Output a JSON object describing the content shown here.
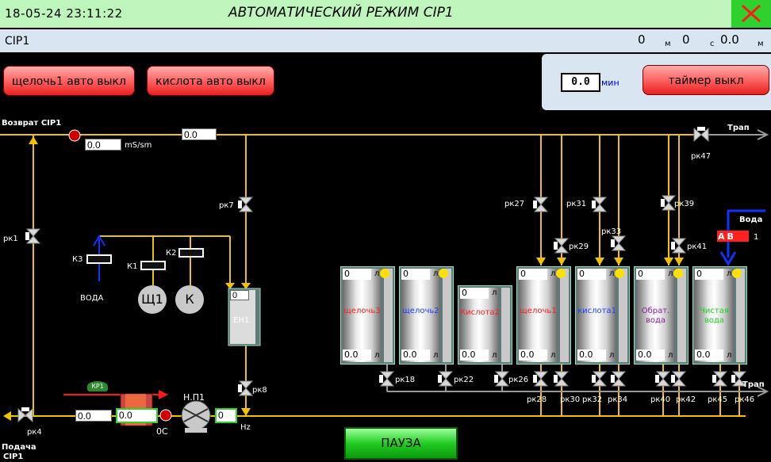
{
  "header": {
    "datetime": "18-05-24 23:11:22",
    "title": "АВТОМАТИЧЕСКИЙ РЕЖИМ CIP1"
  },
  "subheader": {
    "name": "CIP1",
    "h": "0",
    "h_unit": "м",
    "m": "0",
    "m_unit": "с",
    "s": "0.0",
    "s_unit": "м"
  },
  "buttons": {
    "alkali": "щелочь1 авто выкл",
    "acid": "кислота авто выкл",
    "timer": "таймер выкл",
    "pause": "ПАУЗА"
  },
  "timer": {
    "value": "0.0",
    "unit": "мин"
  },
  "process": {
    "return_label": "Возврат CIP1",
    "conductivity": "0.0",
    "conductivity_unit": "mS/sm",
    "return_value": "0.0",
    "drain_label": "Трап",
    "drain_label2": "Трап",
    "water_label": "Вода",
    "water_lower": "ВОДА",
    "supply_label_1": "Подача",
    "supply_label_2": "CIP1",
    "temp_pre": "0.0",
    "temp": "0.0",
    "temp_unit": "0С",
    "pump_name": "Н.П1",
    "pump_freq": "0",
    "pump_freq_unit": "Hz",
    "heater_valve": "КР1",
    "heater_tank": "ЕН1",
    "heater_tank_value": "0",
    "dosing": {
      "k3": "К3",
      "k1": "К1",
      "k2": "К2",
      "sh1": "Щ1",
      "k": "К"
    },
    "ab_label": "АВ",
    "ab_suffix": "1"
  },
  "valves": {
    "rk1": "рк1",
    "rk4": "рк4",
    "rk7": "рк7",
    "rk8": "рк8",
    "rk47": "рк47",
    "rk27": "рк27",
    "rk31": "рк31",
    "rk39": "рк39",
    "rk29": "рк29",
    "rk33": "рк33",
    "rk41": "рк41",
    "rk18": "рк18",
    "rk22": "рк22",
    "rk26": "рк26",
    "rk28": "рк28",
    "rk30": "рк30",
    "rk32": "рк32",
    "rk34": "рк34",
    "rk40": "рк40",
    "rk42": "рк42",
    "rk45": "рк45",
    "rk46": "рк46"
  },
  "tanks": [
    {
      "name": "щелочь3",
      "top": "0",
      "bottom": "0.0",
      "unit": "л",
      "color": "#ff2020"
    },
    {
      "name": "щелочь2",
      "top": "0",
      "bottom": "0.0",
      "unit": "л",
      "color": "#2040ff"
    },
    {
      "name": "Кислота2",
      "top": "0",
      "bottom": "0.0",
      "unit": "л",
      "color": "#ff2020"
    },
    {
      "name": "щелочь1",
      "top": "0",
      "bottom": "0.0",
      "unit": "л",
      "color": "#ff2020"
    },
    {
      "name": "кислота1",
      "top": "0",
      "bottom": "0.0",
      "unit": "л",
      "color": "#2040ff"
    },
    {
      "name": "Обрат. вода",
      "top": "0",
      "bottom": "0.0",
      "unit": "л",
      "color": "#9020a0"
    },
    {
      "name": "Чистая вода",
      "top": "0",
      "bottom": "0.0",
      "unit": "л",
      "color": "#20d020"
    }
  ]
}
